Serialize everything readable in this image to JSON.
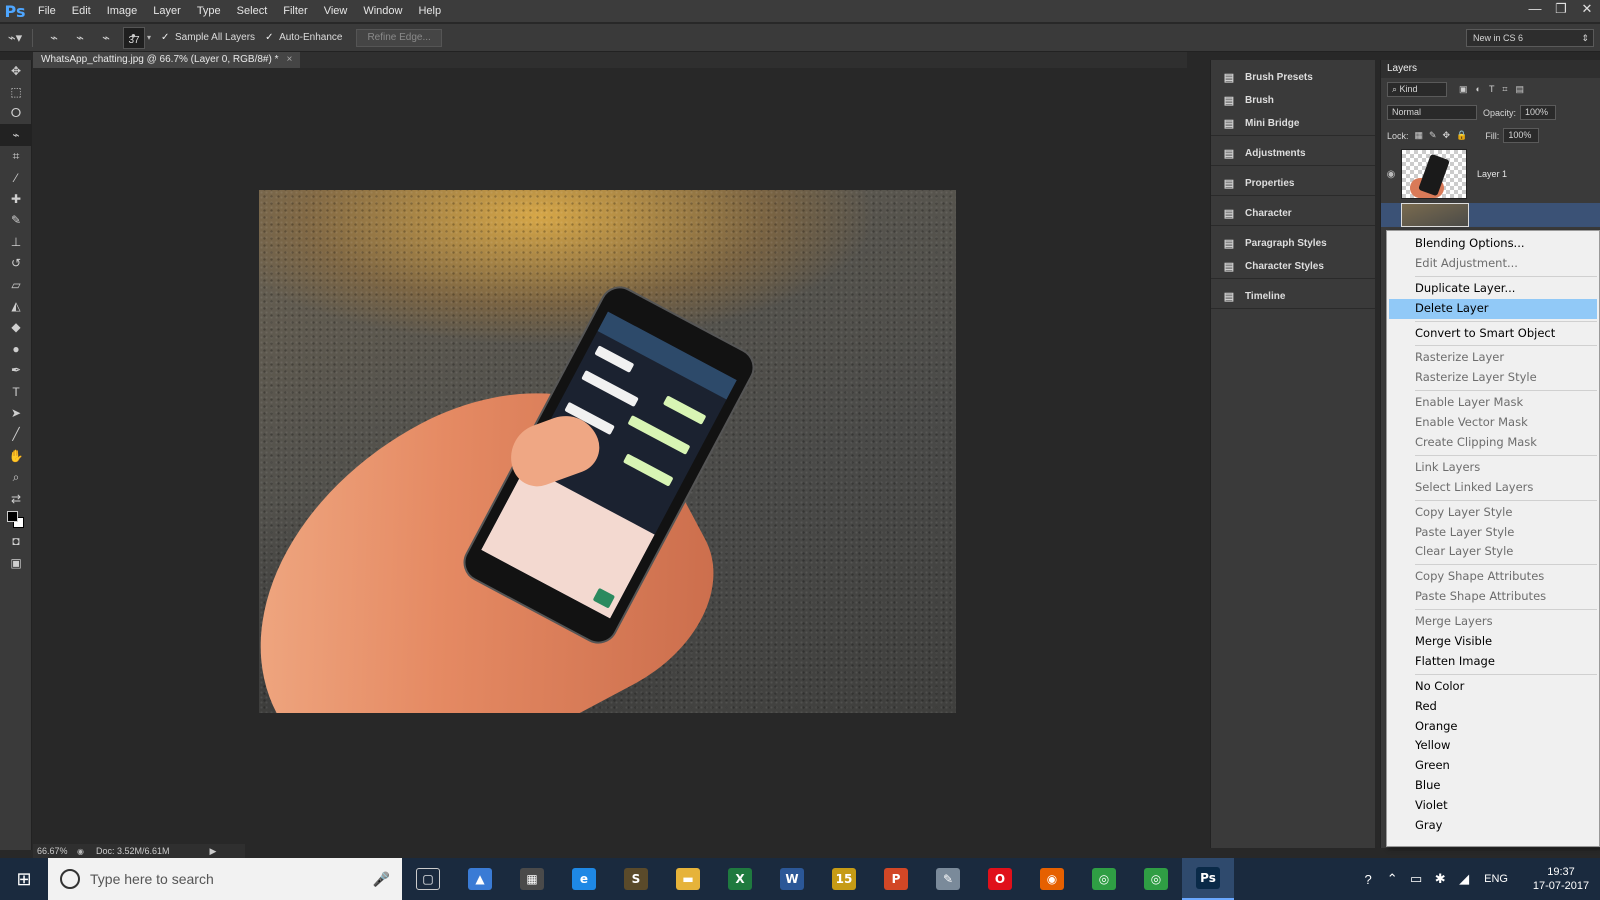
{
  "app": {
    "logo": "Ps"
  },
  "menu": [
    "File",
    "Edit",
    "Image",
    "Layer",
    "Type",
    "Select",
    "Filter",
    "View",
    "Window",
    "Help"
  ],
  "window_controls": [
    "—",
    "❐",
    "✕"
  ],
  "options": {
    "brush_size": "37",
    "sample_all_layers": "Sample All Layers",
    "auto_enhance": "Auto-Enhance",
    "refine_edge": "Refine Edge...",
    "workspace": "New in CS 6"
  },
  "document": {
    "tab_title": "WhatsApp_chatting.jpg @ 66.7% (Layer 0, RGB/8#) *",
    "tab_close": "×"
  },
  "status": {
    "zoom": "66.67%",
    "doc": "Doc: 3.52M/6.61M",
    "arrow": "▶"
  },
  "dock": {
    "groups": [
      [
        {
          "label": "Brush Presets",
          "icon": "brush-presets-icon"
        },
        {
          "label": "Brush",
          "icon": "brush-icon"
        },
        {
          "label": "Mini Bridge",
          "icon": "mini-bridge-icon"
        }
      ],
      [
        {
          "label": "Adjustments",
          "icon": "adjustments-icon"
        }
      ],
      [
        {
          "label": "Properties",
          "icon": "properties-icon"
        }
      ],
      [
        {
          "label": "Character",
          "icon": "character-icon"
        }
      ],
      [
        {
          "label": "Paragraph Styles",
          "icon": "paragraph-styles-icon"
        },
        {
          "label": "Character Styles",
          "icon": "character-styles-icon"
        }
      ],
      [
        {
          "label": "Timeline",
          "icon": "timeline-icon"
        }
      ]
    ]
  },
  "layers": {
    "tab": "Layers",
    "kind": "Kind",
    "blend_mode": "Normal",
    "opacity_label": "Opacity:",
    "opacity": "100%",
    "lock_label": "Lock:",
    "fill_label": "Fill:",
    "fill": "100%",
    "items": [
      {
        "name": "Layer 1"
      }
    ]
  },
  "context_menu": {
    "items": [
      {
        "label": "Blending Options...",
        "state": "enabled"
      },
      {
        "label": "Edit Adjustment...",
        "state": "disabled"
      },
      {
        "sep": true
      },
      {
        "label": "Duplicate Layer...",
        "state": "enabled"
      },
      {
        "label": "Delete Layer",
        "state": "selected"
      },
      {
        "sep": true
      },
      {
        "label": "Convert to Smart Object",
        "state": "enabled"
      },
      {
        "sep": true
      },
      {
        "label": "Rasterize Layer",
        "state": "disabled"
      },
      {
        "label": "Rasterize Layer Style",
        "state": "disabled"
      },
      {
        "sep": true
      },
      {
        "label": "Enable Layer Mask",
        "state": "disabled"
      },
      {
        "label": "Enable Vector Mask",
        "state": "disabled"
      },
      {
        "label": "Create Clipping Mask",
        "state": "disabled"
      },
      {
        "sep": true
      },
      {
        "label": "Link Layers",
        "state": "disabled"
      },
      {
        "label": "Select Linked Layers",
        "state": "disabled"
      },
      {
        "sep": true
      },
      {
        "label": "Copy Layer Style",
        "state": "disabled"
      },
      {
        "label": "Paste Layer Style",
        "state": "disabled"
      },
      {
        "label": "Clear Layer Style",
        "state": "disabled"
      },
      {
        "sep": true
      },
      {
        "label": "Copy Shape Attributes",
        "state": "disabled"
      },
      {
        "label": "Paste Shape Attributes",
        "state": "disabled"
      },
      {
        "sep": true
      },
      {
        "label": "Merge Layers",
        "state": "disabled"
      },
      {
        "label": "Merge Visible",
        "state": "enabled"
      },
      {
        "label": "Flatten Image",
        "state": "enabled"
      },
      {
        "sep": true
      },
      {
        "label": "No Color",
        "state": "enabled"
      },
      {
        "label": "Red",
        "state": "enabled"
      },
      {
        "label": "Orange",
        "state": "enabled"
      },
      {
        "label": "Yellow",
        "state": "enabled"
      },
      {
        "label": "Green",
        "state": "enabled"
      },
      {
        "label": "Blue",
        "state": "enabled"
      },
      {
        "label": "Violet",
        "state": "enabled"
      },
      {
        "label": "Gray",
        "state": "enabled"
      }
    ]
  },
  "taskbar": {
    "search_placeholder": "Type here to search",
    "apps": [
      {
        "name": "task-view-icon",
        "glyph": "▢"
      },
      {
        "name": "photos-icon",
        "glyph": "▲",
        "color": "#3a7bd5"
      },
      {
        "name": "store-icon",
        "glyph": "▦",
        "color": "#4a4a4a"
      },
      {
        "name": "edge-icon",
        "glyph": "e",
        "color": "#1e88e5"
      },
      {
        "name": "sublime-icon",
        "glyph": "S",
        "color": "#5a4a2a"
      },
      {
        "name": "file-explorer-icon",
        "glyph": "▬",
        "color": "#e6b33a"
      },
      {
        "name": "excel-icon",
        "glyph": "X",
        "color": "#1f7a3f"
      },
      {
        "name": "word-icon",
        "glyph": "W",
        "color": "#2b5797"
      },
      {
        "name": "fifteen-icon",
        "glyph": "15",
        "color": "#c69b15"
      },
      {
        "name": "powerpoint-icon",
        "glyph": "P",
        "color": "#d24726"
      },
      {
        "name": "paint-icon",
        "glyph": "✎",
        "color": "#7a8a9a"
      },
      {
        "name": "opera-icon",
        "glyph": "O",
        "color": "#e0101a"
      },
      {
        "name": "firefox-icon",
        "glyph": "◉",
        "color": "#e66000"
      },
      {
        "name": "chrome-icon",
        "glyph": "◎",
        "color": "#2f9e44"
      },
      {
        "name": "chrome-user-icon",
        "glyph": "◎",
        "color": "#2f9e44"
      },
      {
        "name": "photoshop-icon",
        "glyph": "Ps",
        "color": "#0a2a48",
        "active": true
      }
    ],
    "language": "ENG",
    "time": "19:37",
    "date": "17-07-2017"
  }
}
